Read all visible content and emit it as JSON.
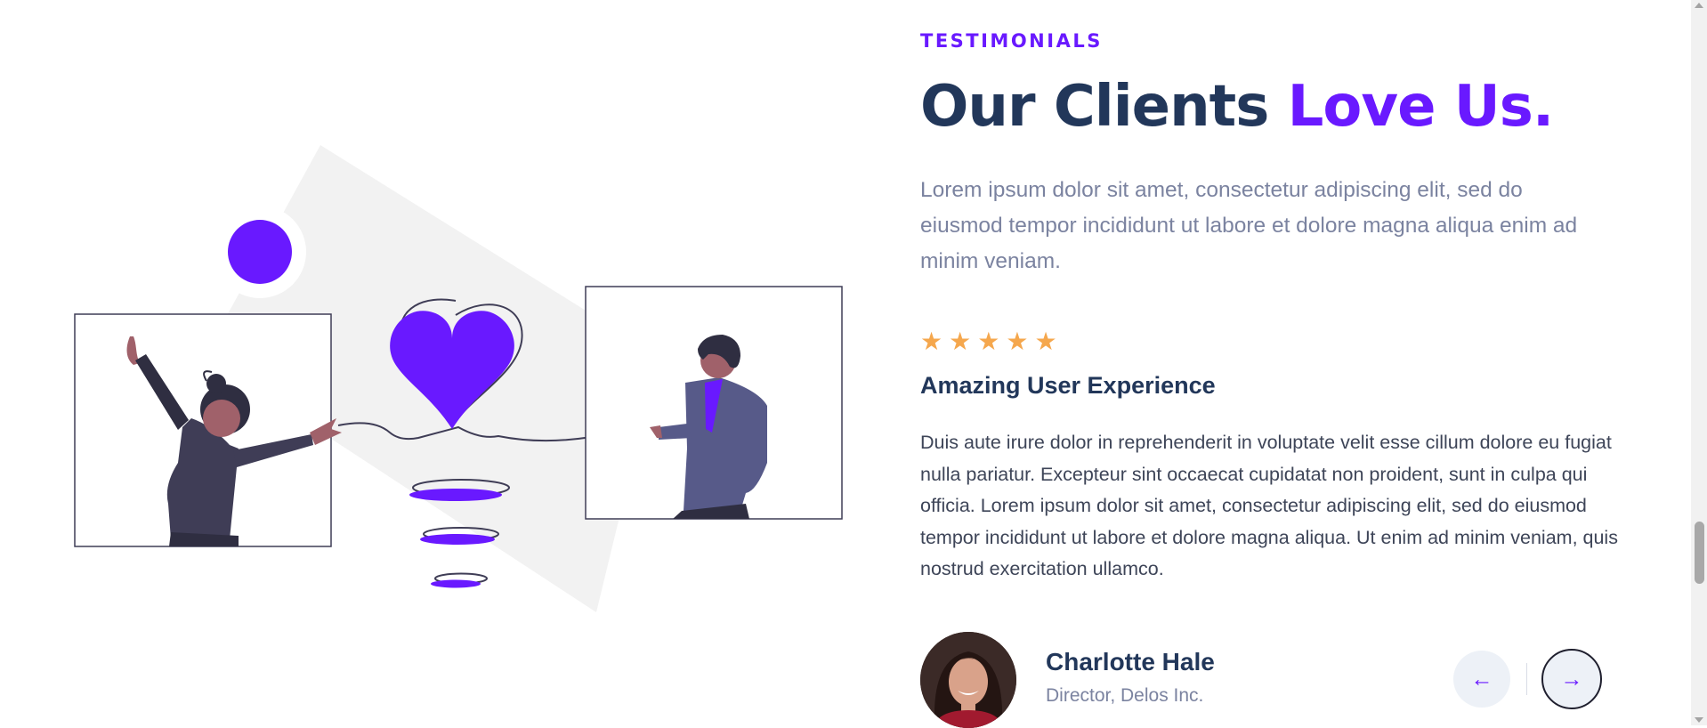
{
  "section": {
    "eyebrow": "TESTIMONIALS",
    "heading_main": "Our Clients ",
    "heading_accent": "Love Us.",
    "intro": "Lorem ipsum dolor sit amet, consectetur adipiscing elit, sed do eiusmod tempor incididunt ut labore et dolore magna aliqua enim ad minim veniam."
  },
  "testimonial": {
    "rating": 5,
    "rating_max": 5,
    "title": "Amazing User Experience",
    "body": "Duis aute irure dolor in reprehenderit in voluptate velit esse cillum dolore eu fugiat nulla pariatur. Excepteur sint occaecat cupidatat non proident, sunt in culpa qui officia. Lorem ipsum dolor sit amet, consectetur adipiscing elit, sed do eiusmod tempor incididunt ut labore et dolore magna aliqua. Ut enim ad minim veniam, quis nostrud exercitation ullamco.",
    "author_name": "Charlotte Hale",
    "author_role": "Director, Delos Inc."
  },
  "icons": {
    "star": "star-icon",
    "prev": "arrow-left-icon",
    "next": "arrow-right-icon"
  },
  "colors": {
    "accent": "#6919ff",
    "heading": "#22375a",
    "muted": "#7b83a0",
    "star": "#f5a74d"
  }
}
